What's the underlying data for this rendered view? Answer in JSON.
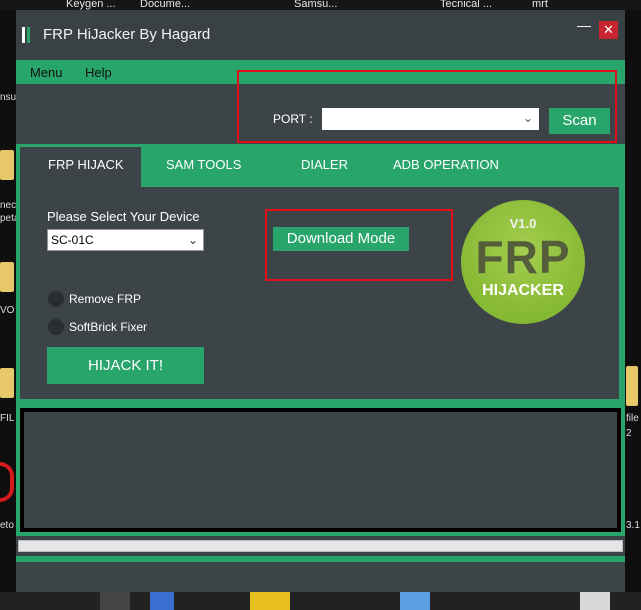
{
  "desktop": {
    "top_labels": [
      "Keygen ...",
      "Docume...",
      "Samsu...",
      "Tecnical ...",
      "mrt"
    ],
    "left_fragments": [
      "nsu",
      "nec",
      "peta",
      "VO",
      "FIL",
      "eto"
    ],
    "right_fragments": [
      "file",
      "2",
      "3.1"
    ]
  },
  "window": {
    "title": "FRP HiJacker By Hagard",
    "minimize_glyph": "—",
    "close_glyph": "✕"
  },
  "menu": {
    "items": [
      "Menu",
      "Help"
    ]
  },
  "port": {
    "label": "PORT :",
    "value": "",
    "scan_label": "Scan"
  },
  "tabs": {
    "items": [
      "FRP HIJACK",
      "SAM TOOLS",
      "DIALER",
      "ADB OPERATION"
    ],
    "active": "FRP HIJACK"
  },
  "device": {
    "label": "Please Select Your Device",
    "selected": "SC-01C"
  },
  "options": {
    "remove_frp": "Remove FRP",
    "softbrick_fixer": "SoftBrick Fixer"
  },
  "buttons": {
    "download_mode": "Download Mode",
    "hijack": "HIJACK IT!"
  },
  "logo": {
    "version": "V1.0",
    "big": "FRP",
    "small": "HIJACKER"
  },
  "log": {
    "text": ""
  },
  "colors": {
    "accent": "#27a56a",
    "window_bg": "#3d4448",
    "highlight_box": "#e0101a",
    "close_red": "#c8262e",
    "logo_green": "#8dbf3a"
  }
}
